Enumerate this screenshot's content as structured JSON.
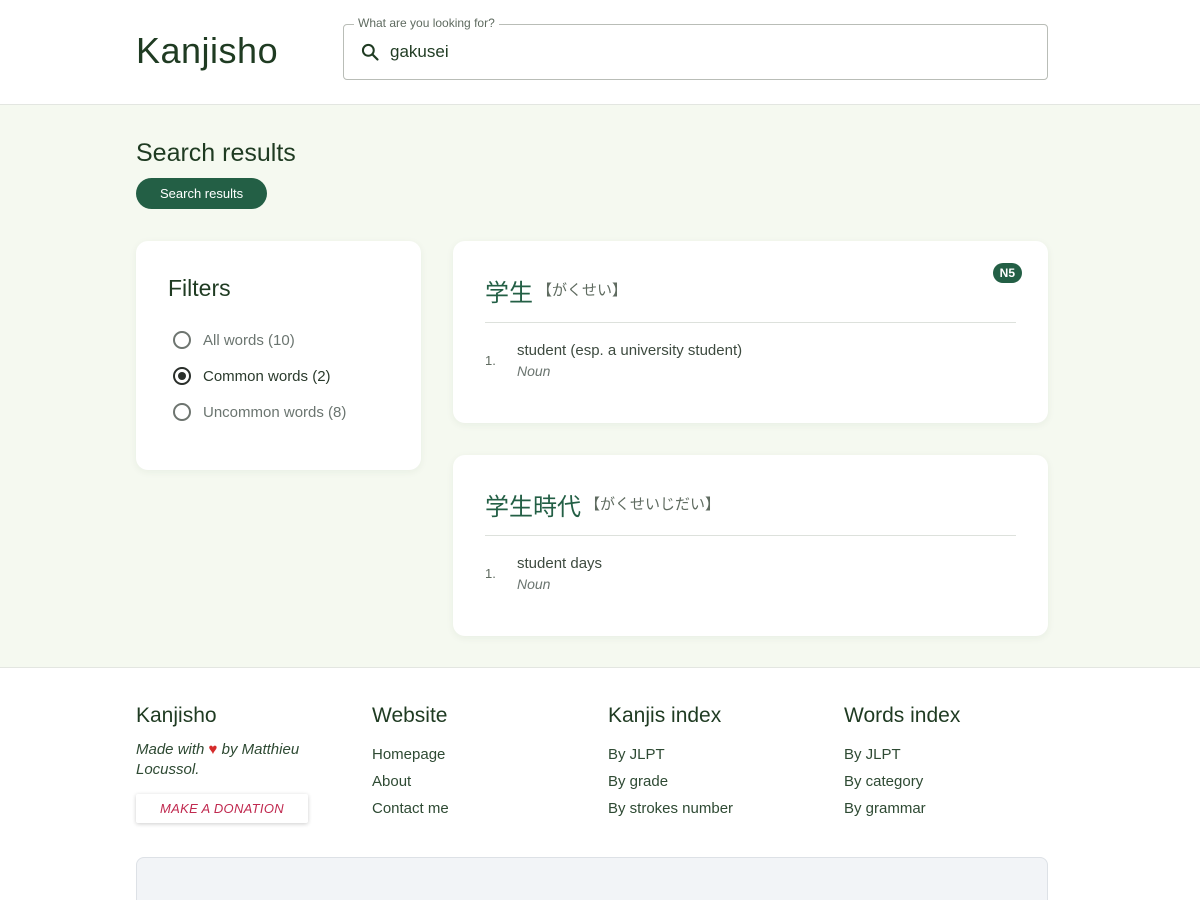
{
  "header": {
    "logo": "Kanjisho",
    "search": {
      "legend": "What are you looking for?",
      "value": "gakusei"
    }
  },
  "main": {
    "title": "Search results",
    "breadcrumb": "Search results",
    "filters": {
      "title": "Filters",
      "options": [
        {
          "label": "All words (10)",
          "checked": false
        },
        {
          "label": "Common words (2)",
          "checked": true
        },
        {
          "label": "Uncommon words (8)",
          "checked": false
        }
      ]
    },
    "results": [
      {
        "kanji": "学生",
        "reading": "【がくせい】",
        "badge": "N5",
        "senses": [
          {
            "num": "1.",
            "gloss": "student (esp. a university student)",
            "pos": "Noun"
          }
        ]
      },
      {
        "kanji": "学生時代",
        "reading": "【がくせいじだい】",
        "badge": "",
        "senses": [
          {
            "num": "1.",
            "gloss": "student days",
            "pos": "Noun"
          }
        ]
      }
    ]
  },
  "footer": {
    "brand": {
      "title": "Kanjisho",
      "made_prefix": "Made with",
      "heart": "♥",
      "made_suffix": "by Matthieu Locussol.",
      "donate": "MAKE A DONATION"
    },
    "website": {
      "title": "Website",
      "links": [
        "Homepage",
        "About",
        "Contact me"
      ]
    },
    "kanjis_index": {
      "title": "Kanjis index",
      "links": [
        "By JLPT",
        "By grade",
        "By strokes number"
      ]
    },
    "words_index": {
      "title": "Words index",
      "links": [
        "By JLPT",
        "By category",
        "By grammar"
      ]
    }
  },
  "colors": {
    "primary": "#235f45",
    "background": "#f5f9f0",
    "donate": "#c0294f"
  }
}
